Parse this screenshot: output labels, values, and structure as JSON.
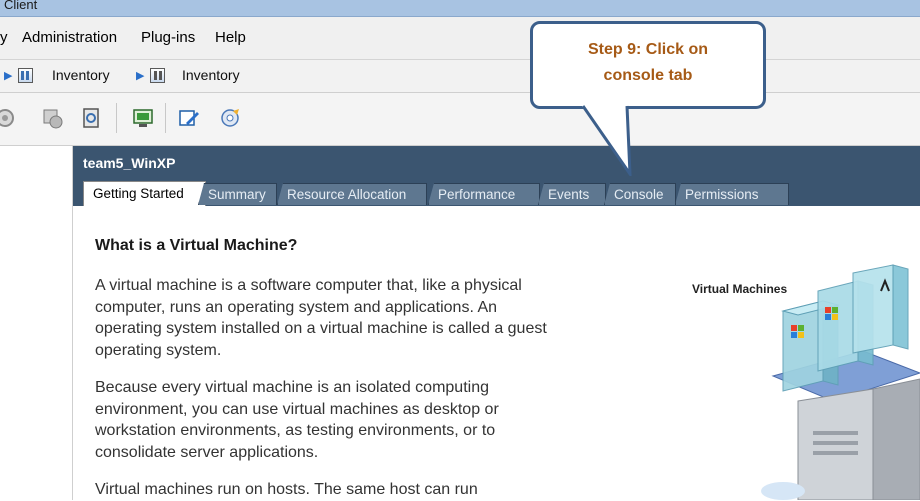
{
  "window": {
    "title": "Client"
  },
  "menu": {
    "items": [
      "y",
      "Administration",
      "Plug-ins",
      "Help"
    ]
  },
  "nav": {
    "crumbs": [
      "Inventory",
      "Inventory"
    ]
  },
  "toolbar": {
    "icons": [
      "power-off-icon",
      "suspend-icon",
      "reset-icon",
      "console-icon",
      "edit-settings-icon",
      "snapshot-icon"
    ]
  },
  "vm": {
    "name": "team5_WinXP",
    "tabs": [
      "Getting Started",
      "Summary",
      "Resource Allocation",
      "Performance",
      "Events",
      "Console",
      "Permissions"
    ],
    "active_tab": "Getting Started"
  },
  "content": {
    "heading": "What is a Virtual Machine?",
    "paragraphs": [
      "A virtual machine is a software computer that, like a physical computer, runs an operating system and applications. An operating system installed on a virtual machine is called a guest operating system.",
      "Because every virtual machine is an isolated computing environment, you can use virtual machines as desktop or workstation environments, as testing environments, or to consolidate server applications.",
      "Virtual machines run on hosts. The same host can run"
    ],
    "illustration_label": "Virtual Machines"
  },
  "callout": {
    "line1": "Step 9: Click on",
    "line2": "console tab"
  },
  "colors": {
    "header_bg": "#3b5570",
    "callout_border": "#3c5f8b",
    "callout_text": "#a65a16"
  }
}
